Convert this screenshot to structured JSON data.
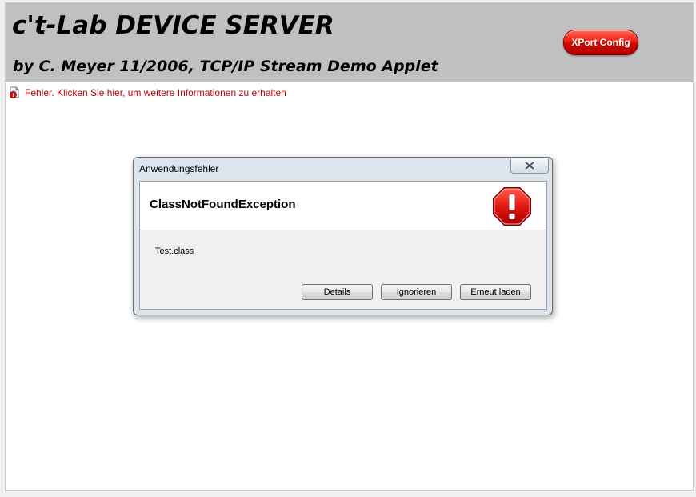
{
  "banner": {
    "title": "c't-Lab DEVICE SERVER",
    "subtitle": "by C. Meyer 11/2006, TCP/IP Stream Demo Applet",
    "xport_button": "XPort Config",
    "background_color": "#c0c0c0"
  },
  "error_bar": {
    "icon": "error-document-icon",
    "text": "Fehler. Klicken Sie hier, um weitere Informationen zu erhalten",
    "color": "#c00000"
  },
  "dialog": {
    "window_title": "Anwendungsfehler",
    "close_icon": "close-x-icon",
    "exception": "ClassNotFoundException",
    "status_icon": "stop-exclamation-icon",
    "message": "Test.class",
    "buttons": {
      "details": "Details",
      "ignore": "Ignorieren",
      "reload": "Erneut laden"
    }
  }
}
